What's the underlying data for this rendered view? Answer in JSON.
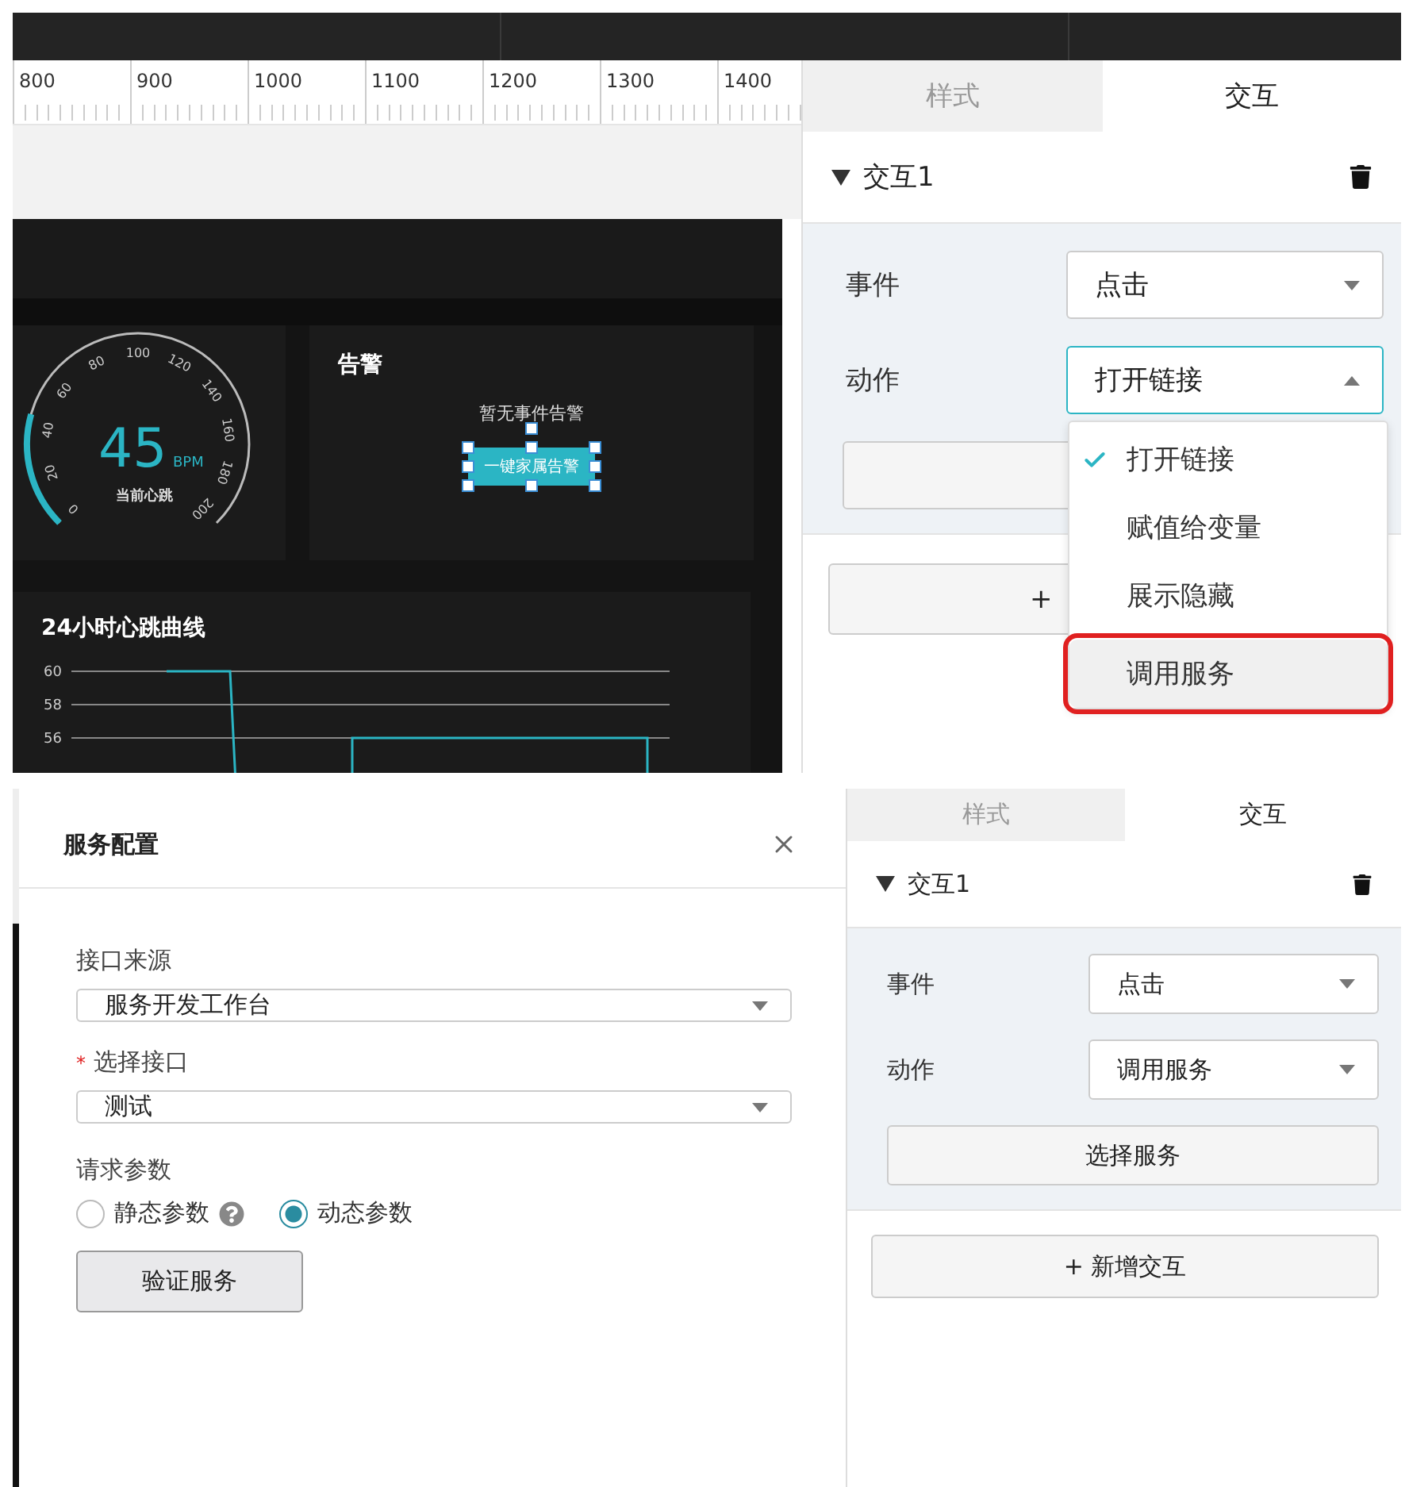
{
  "ruler": {
    "labels": [
      "800",
      "900",
      "1000",
      "1100",
      "1200",
      "1300",
      "1400"
    ]
  },
  "dashboard": {
    "gauge": {
      "ticks": [
        "0",
        "20",
        "40",
        "60",
        "80",
        "100",
        "120",
        "140",
        "160",
        "180",
        "200"
      ],
      "value": "45",
      "unit": "BPM",
      "label": "当前心跳"
    },
    "alert": {
      "title": "告警",
      "message": "暂无事件告警",
      "button": "一键家属告警",
      "selected": true
    },
    "chart": {
      "title": "24小时心跳曲线",
      "y_labels": [
        "60",
        "58",
        "56"
      ]
    }
  },
  "panel_top": {
    "tabs": [
      {
        "label": "样式",
        "selected": false
      },
      {
        "label": "交互",
        "selected": true
      }
    ],
    "interaction": {
      "title": "交互1",
      "expanded": true,
      "fields": [
        {
          "label": "事件",
          "value": "点击",
          "open": false
        },
        {
          "label": "动作",
          "value": "打开链接",
          "open": true
        }
      ]
    },
    "add_button": "+",
    "menu": [
      {
        "label": "打开链接",
        "selected": true,
        "highlighted": false
      },
      {
        "label": "赋值给变量",
        "selected": false,
        "highlighted": false
      },
      {
        "label": "展示隐藏",
        "selected": false,
        "highlighted": false
      },
      {
        "label": "调用服务",
        "selected": false,
        "highlighted": true
      }
    ]
  },
  "dialog": {
    "title": "服务配置",
    "fields": [
      {
        "label": "接口来源",
        "value": "服务开发工作台"
      },
      {
        "label": "选择接口",
        "required_mark": "*",
        "value": "测试"
      }
    ],
    "params": {
      "label": "请求参数",
      "options": [
        {
          "label": "静态参数",
          "selected": false,
          "help": true
        },
        {
          "label": "动态参数",
          "selected": true,
          "help": false
        }
      ]
    },
    "button": "验证服务"
  },
  "panel_bottom": {
    "tabs": [
      {
        "label": "样式",
        "selected": false
      },
      {
        "label": "交互",
        "selected": true
      }
    ],
    "interaction": {
      "title": "交互1",
      "expanded": true,
      "fields": [
        {
          "label": "事件",
          "value": "点击",
          "open": false
        },
        {
          "label": "动作",
          "value": "调用服务",
          "open": false
        }
      ],
      "service_button": "选择服务"
    },
    "add_button": "+ 新增交互"
  }
}
